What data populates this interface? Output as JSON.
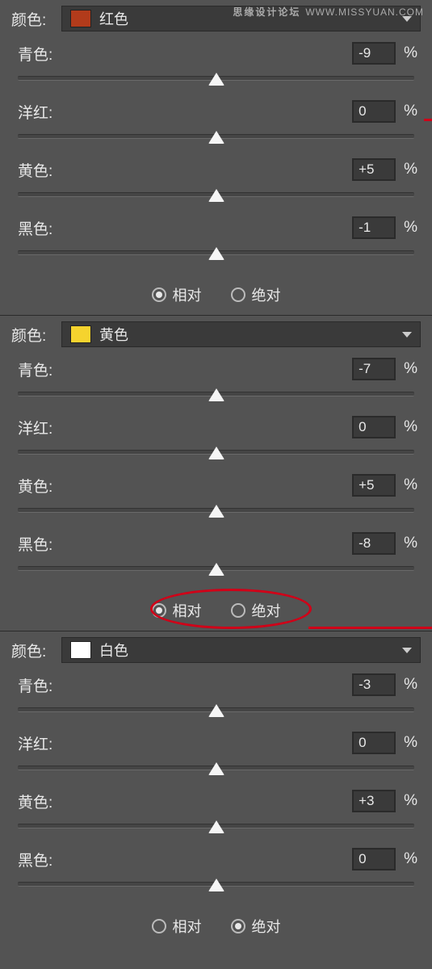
{
  "watermark": {
    "cn": "思缘设计论坛",
    "url": "WWW.MISSYUAN.COM"
  },
  "labels": {
    "color": "颜色:",
    "cyan": "青色:",
    "magenta": "洋红:",
    "yellow": "黄色:",
    "black": "黑色:",
    "relative": "相对",
    "absolute": "绝对",
    "pct": "%"
  },
  "sections": [
    {
      "swatch": "#b23b1b",
      "name": "红色",
      "sliders": {
        "cyan": "-9",
        "magenta": "0",
        "yellow": "+5",
        "black": "-1"
      },
      "mode": "relative",
      "annot_ellipse": false
    },
    {
      "swatch": "#f5d32e",
      "name": "黄色",
      "sliders": {
        "cyan": "-7",
        "magenta": "0",
        "yellow": "+5",
        "black": "-8"
      },
      "mode": "relative",
      "annot_ellipse": true
    },
    {
      "swatch": "#ffffff",
      "name": "白色",
      "sliders": {
        "cyan": "-3",
        "magenta": "0",
        "yellow": "+3",
        "black": "0"
      },
      "mode": "absolute",
      "annot_ellipse": false
    }
  ]
}
